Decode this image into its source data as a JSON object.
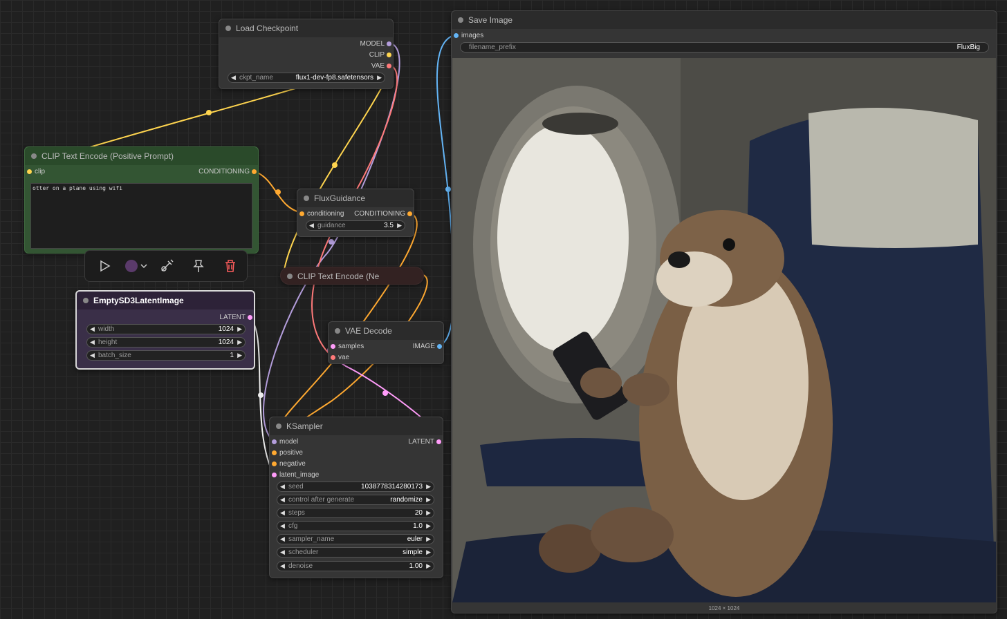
{
  "colors": {
    "model": "#b39ddb",
    "clip": "#ffd54f",
    "vae": "#ff7a7a",
    "conditioning": "#ffa931",
    "latent": "#ff9cf9",
    "image": "#64b5f6"
  },
  "load_checkpoint": {
    "title": "Load Checkpoint",
    "outputs": [
      "MODEL",
      "CLIP",
      "VAE"
    ],
    "ckpt_label": "ckpt_name",
    "ckpt_value": "flux1-dev-fp8.safetensors"
  },
  "clip_positive": {
    "title": "CLIP Text Encode (Positive Prompt)",
    "input": "clip",
    "output": "CONDITIONING",
    "text": "otter on a plane using wifi"
  },
  "flux_guidance": {
    "title": "FluxGuidance",
    "input": "conditioning",
    "output": "CONDITIONING",
    "guidance_label": "guidance",
    "guidance_value": "3.5"
  },
  "clip_negative": {
    "title": "CLIP Text Encode (Ne"
  },
  "empty_latent": {
    "title": "EmptySD3LatentImage",
    "output": "LATENT",
    "widgets": [
      {
        "label": "width",
        "value": "1024"
      },
      {
        "label": "height",
        "value": "1024"
      },
      {
        "label": "batch_size",
        "value": "1"
      }
    ]
  },
  "vae_decode": {
    "title": "VAE Decode",
    "inputs": [
      "samples",
      "vae"
    ],
    "output": "IMAGE"
  },
  "ksampler": {
    "title": "KSampler",
    "inputs": [
      "model",
      "positive",
      "negative",
      "latent_image"
    ],
    "output": "LATENT",
    "widgets": [
      {
        "label": "seed",
        "value": "1038778314280173"
      },
      {
        "label": "control after generate",
        "value": "randomize"
      },
      {
        "label": "steps",
        "value": "20"
      },
      {
        "label": "cfg",
        "value": "1.0"
      },
      {
        "label": "sampler_name",
        "value": "euler"
      },
      {
        "label": "scheduler",
        "value": "simple"
      },
      {
        "label": "denoise",
        "value": "1.00"
      }
    ]
  },
  "save_image": {
    "title": "Save Image",
    "input": "images",
    "prefix_label": "filename_prefix",
    "prefix_value": "FluxBig",
    "image_size": "1024 × 1024"
  }
}
